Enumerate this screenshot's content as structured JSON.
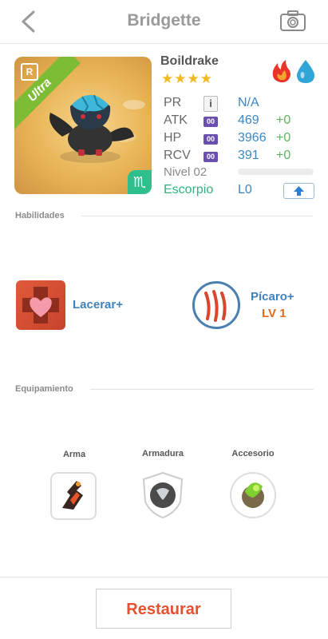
{
  "header": {
    "title": "Bridgette",
    "back_icon": "chevron-left-icon",
    "camera_icon": "camera-icon"
  },
  "monster": {
    "rarity": "Ultra",
    "rarity_badge": "R",
    "name": "Boildrake",
    "stars": "★★★★",
    "star_count": 4,
    "elements": [
      "fire-icon",
      "water-icon"
    ],
    "zodiac_symbol": "♏",
    "stats": {
      "pr": {
        "label": "PR",
        "value": "N/A"
      },
      "atk": {
        "label": "ATK",
        "value": "469",
        "bonus": "+0"
      },
      "hp": {
        "label": "HP",
        "value": "3966",
        "bonus": "+0"
      },
      "rcv": {
        "label": "RCV",
        "value": "391",
        "bonus": "+0"
      },
      "oo_badge": "00"
    },
    "level_label": "Nivel 02",
    "level_progress": 0,
    "zodiac_name": "Escorpio",
    "l_value": "L0"
  },
  "skills": {
    "section_label": "Habilidades",
    "items": [
      {
        "name": "Lacerar+",
        "icon": "heart-cross-icon"
      },
      {
        "name": "Pícaro+",
        "level": "LV 1",
        "icon": "claw-icon"
      }
    ]
  },
  "equipment": {
    "section_label": "Equipamiento",
    "slots": [
      {
        "label": "Arma",
        "icon": "weapon-icon"
      },
      {
        "label": "Armadura",
        "icon": "armor-icon"
      },
      {
        "label": "Accesorio",
        "icon": "accessory-icon"
      }
    ]
  },
  "footer": {
    "restore_label": "Restaurar"
  },
  "colors": {
    "accent_blue": "#3d86c6",
    "green": "#5cb85c",
    "orange": "#e7502f",
    "ultra": "#7dbd36"
  }
}
